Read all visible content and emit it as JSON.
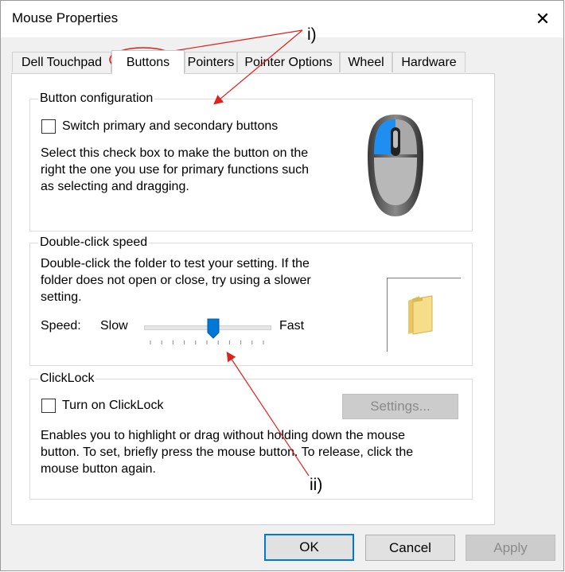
{
  "window": {
    "title": "Mouse Properties"
  },
  "tabs": [
    {
      "label": "Dell Touchpad"
    },
    {
      "label": "Buttons"
    },
    {
      "label": "Pointers"
    },
    {
      "label": "Pointer Options"
    },
    {
      "label": "Wheel"
    },
    {
      "label": "Hardware"
    }
  ],
  "active_tab": "Buttons",
  "button_config": {
    "legend": "Button configuration",
    "checkbox_label": "Switch primary and secondary buttons",
    "checked": false,
    "desc_lines": [
      "Select this check box to make the button on the",
      "right the one you use for primary functions such",
      "as selecting and dragging."
    ]
  },
  "double_click": {
    "legend": "Double-click speed",
    "desc_lines": [
      "Double-click the folder to test your setting. If the",
      "folder does not open or close, try using a slower",
      "setting."
    ],
    "speed_label": "Speed:",
    "slow_label": "Slow",
    "fast_label": "Fast",
    "slider_value": 0.55
  },
  "clicklock": {
    "legend": "ClickLock",
    "checkbox_label": "Turn on ClickLock",
    "checked": false,
    "settings_label": "Settings...",
    "desc_lines": [
      "Enables you to highlight or drag without holding down the mouse",
      "button. To set, briefly press the mouse button. To release, click the",
      "mouse button again."
    ]
  },
  "footer": {
    "ok_label": "OK",
    "cancel_label": "Cancel",
    "apply_label": "Apply"
  },
  "annotations": {
    "one": "i)",
    "two": "ii)"
  },
  "colors": {
    "accent": "#0078d7",
    "annotation": "#e0201b",
    "mouse_blue": "#1e8ff0"
  }
}
